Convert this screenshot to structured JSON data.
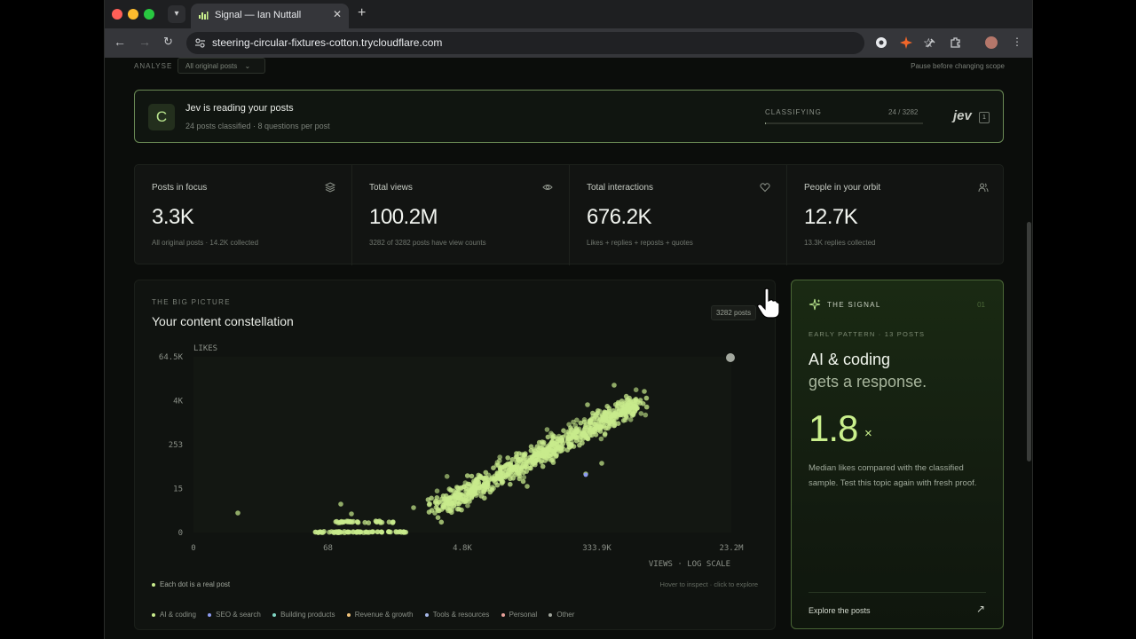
{
  "browser": {
    "tab_title": "Signal — Ian Nuttall",
    "url": "steering-circular-fixtures-cotton.trycloudflare.com",
    "traffic_colors": [
      "#ff5f57",
      "#febc2e",
      "#28c840"
    ]
  },
  "top": {
    "analyse_label": "ANALYSE",
    "scope_value": "All original posts",
    "scope_note": "Pause before changing scope"
  },
  "banner": {
    "letter": "C",
    "title": "Jev is reading your posts",
    "subtitle": "24 posts classified · 8 questions per post",
    "status_label": "CLASSIFYING",
    "progress_text": "24 / 3282",
    "progress_fraction": 0.0073,
    "logo": "jev",
    "badge": "1"
  },
  "stats": [
    {
      "label": "Posts in focus",
      "value": "3.3K",
      "sub": "All original posts · 14.2K collected",
      "icon": "layers-icon"
    },
    {
      "label": "Total views",
      "value": "100.2M",
      "sub": "3282 of 3282 posts have view counts",
      "icon": "eye-icon"
    },
    {
      "label": "Total interactions",
      "value": "676.2K",
      "sub": "Likes + replies + reposts + quotes",
      "icon": "heart-icon"
    },
    {
      "label": "People in your orbit",
      "value": "12.7K",
      "sub": "13.3K replies collected",
      "icon": "people-icon"
    }
  ],
  "bigpicture": {
    "kicker": "THE BIG PICTURE",
    "title": "Your content constellation",
    "count_badge": "3282 posts",
    "legend_note": "Each dot is a real post",
    "hint": "Hover to inspect · click to explore",
    "categories": [
      {
        "name": "AI & coding",
        "color": "#c8eb8c"
      },
      {
        "name": "SEO & search",
        "color": "#8d9cf0"
      },
      {
        "name": "Building products",
        "color": "#7fd6c4"
      },
      {
        "name": "Revenue & growth",
        "color": "#f0c27a"
      },
      {
        "name": "Tools & resources",
        "color": "#a6b8e8"
      },
      {
        "name": "Personal",
        "color": "#e8a19a"
      },
      {
        "name": "Other",
        "color": "#a0a59c"
      }
    ]
  },
  "chart_data": {
    "type": "scatter",
    "title": "",
    "xlabel": "VIEWS · LOG SCALE",
    "ylabel": "LIKES",
    "x_scale": "log",
    "y_scale": "log",
    "x_ticks": [
      "0",
      "68",
      "4.8K",
      "333.9K",
      "23.2M"
    ],
    "y_ticks": [
      "64.5K",
      "4K",
      "253",
      "15",
      "0"
    ],
    "grid": false,
    "approx_points_visible": 3282,
    "highlight_point": {
      "x": "23.2M",
      "y": "64.5K"
    }
  },
  "signal": {
    "kicker": "THE SIGNAL",
    "number": "01",
    "pattern": "EARLY PATTERN · 13 POSTS",
    "headline_1": "AI & coding",
    "headline_2": "gets a response.",
    "big_value": "1.8",
    "big_suffix": "×",
    "description": "Median likes compared with the classified sample. Test this topic again with fresh proof.",
    "explore": "Explore the posts"
  }
}
